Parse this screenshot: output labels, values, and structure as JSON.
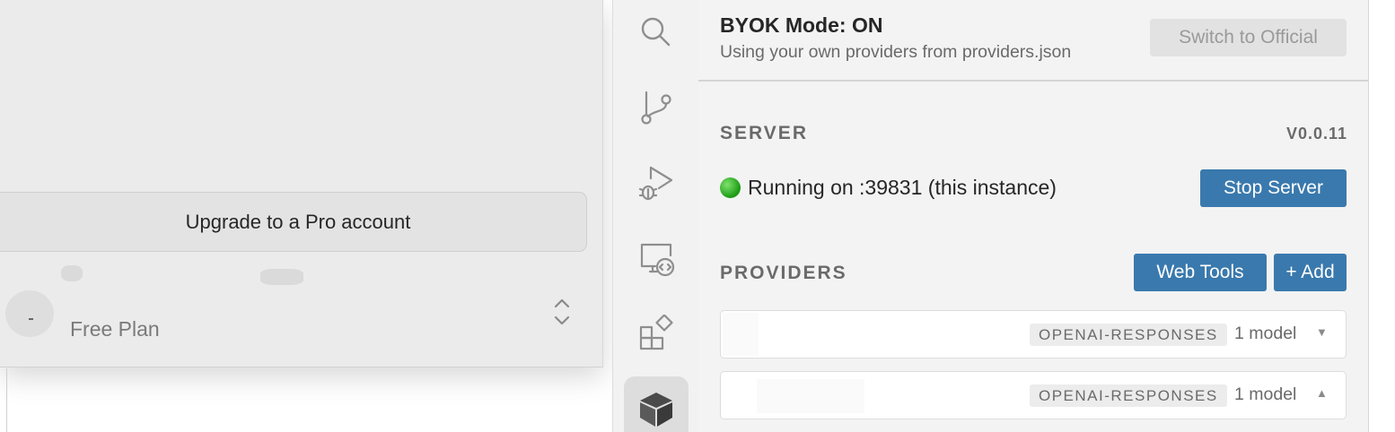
{
  "popup": {
    "upgrade_label": "Upgrade to a Pro account",
    "plan_label": "Free Plan"
  },
  "activity_bar": {
    "icons": [
      "search-icon",
      "source-control-icon",
      "run-debug-icon",
      "remote-explorer-icon",
      "extensions-icon",
      "byok-cube-icon"
    ],
    "active": "byok-cube-icon"
  },
  "byok": {
    "title": "BYOK Mode: ON",
    "subtitle": "Using your own providers from providers.json",
    "switch_label": "Switch to Official"
  },
  "server": {
    "section_title": "SERVER",
    "version": "V0.0.11",
    "status": "Running on :39831 (this instance)",
    "status_color": "#2bb31a",
    "stop_label": "Stop Server"
  },
  "providers": {
    "section_title": "PROVIDERS",
    "web_tools_label": "Web Tools",
    "add_label": "+ Add",
    "items": [
      {
        "type": "OPENAI-RESPONSES",
        "models": "1 model",
        "caret": "▼"
      },
      {
        "type": "OPENAI-RESPONSES",
        "models": "1 model",
        "caret": "▲"
      }
    ]
  },
  "colors": {
    "accent": "#3a79ad",
    "panel_bg": "#f3f3f3"
  }
}
